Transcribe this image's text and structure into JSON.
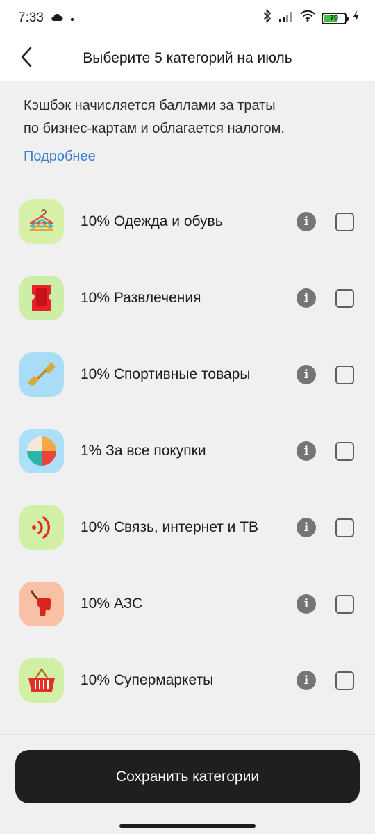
{
  "status_bar": {
    "time": "7:33",
    "battery_level": "70",
    "battery_fraction": 0.7,
    "icons": [
      "cloud-icon",
      "dot-icon",
      "bluetooth-icon",
      "signal-icon",
      "wifi-icon",
      "battery-icon",
      "charging-icon"
    ]
  },
  "header": {
    "title": "Выберите 5 категорий на июль",
    "back_icon": "back-arrow-icon"
  },
  "description": "Кэшбэк начисляется баллами за траты\nпо бизнес-картам и облагается налогом.",
  "more_link": "Подробнее",
  "categories": [
    {
      "label": "10% Одежда и обувь",
      "icon": "hangers-icon",
      "icon_bg": "#d7f0a8",
      "checked": false
    },
    {
      "label": "10% Развлечения",
      "icon": "ticket-icon",
      "icon_bg": "#cdeea6",
      "checked": false
    },
    {
      "label": "10% Спортивные товары",
      "icon": "dumbbell-icon",
      "icon_bg": "#a9dcf7",
      "checked": false
    },
    {
      "label": "1% За все покупки",
      "icon": "pie-icon",
      "icon_bg": "#aedff8",
      "checked": false
    },
    {
      "label": "10% Связь, интернет и ТВ",
      "icon": "signal-waves-icon",
      "icon_bg": "#d2efa6",
      "checked": false
    },
    {
      "label": "10% АЗС",
      "icon": "fuel-nozzle-icon",
      "icon_bg": "#f8c0a4",
      "checked": false
    },
    {
      "label": "10% Супермаркеты",
      "icon": "basket-icon",
      "icon_bg": "#d2efa6",
      "checked": false
    }
  ],
  "save_button": "Сохранить категории",
  "colors": {
    "accent_link": "#3a7fd0",
    "button_bg": "#1f1f1f",
    "page_bg": "#f0f0f0",
    "info_icon": "#757575"
  }
}
